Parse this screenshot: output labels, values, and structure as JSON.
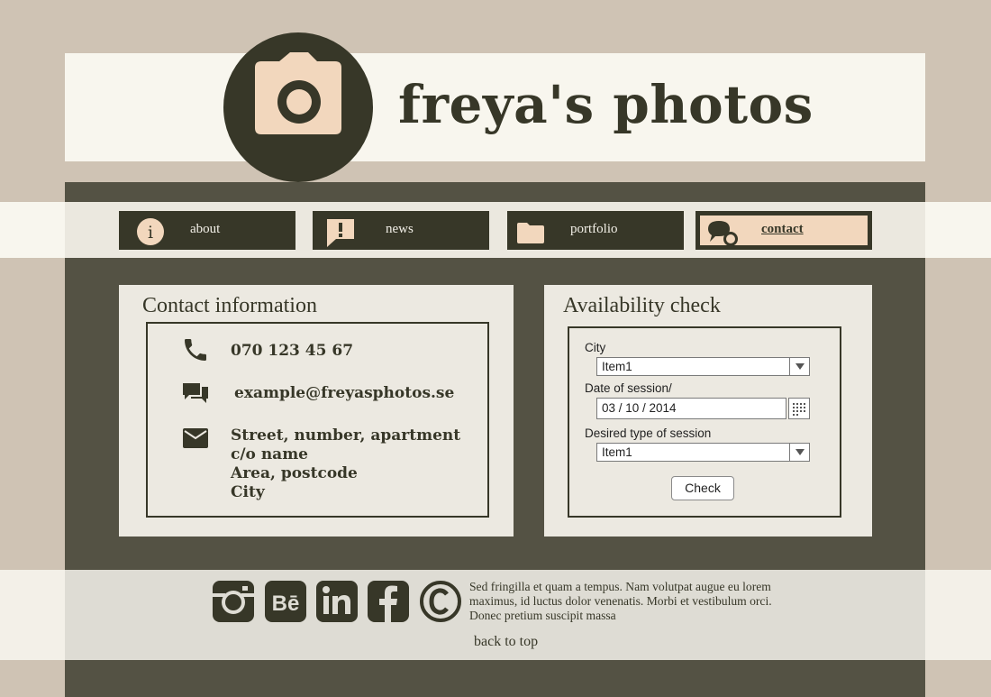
{
  "header": {
    "title": "freya's photos",
    "logo_icon": "camera-icon"
  },
  "nav": {
    "items": [
      {
        "label": "about",
        "icon": "info-icon"
      },
      {
        "label": "news",
        "icon": "alert-chat-icon"
      },
      {
        "label": "portfolio",
        "icon": "folder-icon"
      },
      {
        "label": "contact",
        "icon": "chat-bubbles-icon",
        "active": true
      }
    ]
  },
  "contact": {
    "title": "Contact information",
    "phone": "070 123 45 67",
    "email": "example@freyasphotos.se",
    "address_lines": [
      "Street, number, apartment",
      "c/o name",
      "Area, postcode",
      "City"
    ]
  },
  "availability": {
    "title": "Availability check",
    "city_label": "City",
    "city_value": "Item1",
    "date_label": "Date of session/",
    "date_value": "03 / 10 / 2014",
    "type_label": "Desired type of session",
    "type_value": "Item1",
    "check_label": "Check"
  },
  "footer": {
    "social": [
      "instagram-icon",
      "behance-icon",
      "linkedin-icon",
      "facebook-icon",
      "copyright-icon"
    ],
    "text": "Sed fringilla et quam a tempus. Nam volutpat augue eu lorem maximus, id luctus dolor venenatis. Morbi et vestibulum orci. Donec pretium suscipit massa",
    "back_to_top": "back to top"
  },
  "colors": {
    "dark": "#373728",
    "accent": "#f2d7bd",
    "background": "#cfc3b4",
    "main": "#545244",
    "light": "#f8f6ee"
  }
}
